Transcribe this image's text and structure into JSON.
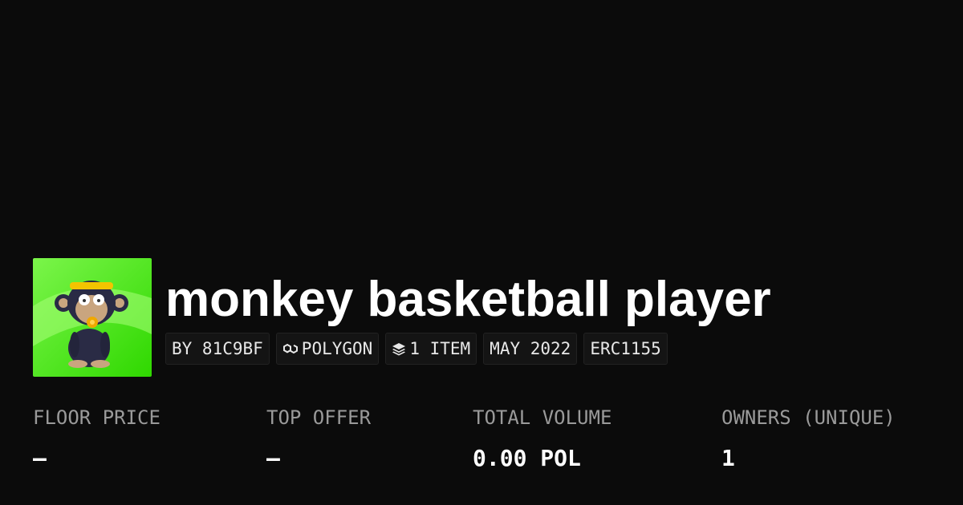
{
  "collection": {
    "title": "monkey basketball player",
    "avatar_alt": "monkey-avatar"
  },
  "badges": [
    {
      "label": "BY 81C9BF",
      "icon": ""
    },
    {
      "label": "POLYGON",
      "icon": "polygon-chain-icon"
    },
    {
      "label": "1 ITEM",
      "icon": "layers-icon"
    },
    {
      "label": "MAY 2022",
      "icon": ""
    },
    {
      "label": "ERC1155",
      "icon": ""
    }
  ],
  "stats": [
    {
      "label": "FLOOR PRICE",
      "value": "–"
    },
    {
      "label": "TOP OFFER",
      "value": "–"
    },
    {
      "label": "TOTAL VOLUME",
      "value": "0.00 POL"
    },
    {
      "label": "OWNERS (UNIQUE)",
      "value": "1"
    }
  ],
  "colors": {
    "background": "#0b0b0b",
    "badge_background": "#141414",
    "label_gray": "#9a9a9a",
    "avatar_green": "#3df000"
  }
}
